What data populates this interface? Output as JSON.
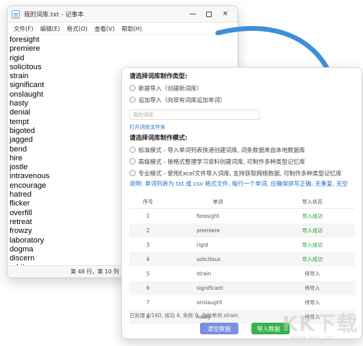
{
  "notepad": {
    "title": "我的词库.txt - 记事本",
    "menu": [
      "文件(F)",
      "编辑(E)",
      "格式(O)",
      "查看(V)",
      "帮助(H)"
    ],
    "lines": [
      "foresight",
      "premiere",
      "rigid",
      "solicitous",
      "strain",
      "significant",
      "onslaught",
      "hasty",
      "denial",
      "tempt",
      "bigoted",
      "jagged",
      "bend",
      "hire",
      "jostle",
      "intravenous",
      "encourage",
      "hatred",
      "flicker",
      "overfill",
      "retreat",
      "frowzy",
      "laboratory",
      "dogma",
      "discern",
      "arbitrary"
    ],
    "status": "第 48 行，第 10 列"
  },
  "tool": {
    "type_heading": "请选择词库制作类型:",
    "type_new": "新建导入（创建新词库）",
    "type_append": "追加导入（向现有词库追加单词）",
    "name_placeholder": "我的词库",
    "open_folder_link": "打开词库文件夹",
    "mode_heading": "请选择词库制作模式:",
    "mode_standard": "标准模式 - 导入单词列表快速创建词库, 词条数据来自本地数据库",
    "mode_advanced": "高级模式 - 按格式整理学习资料创建词库, 可制作多种类型记忆库",
    "mode_pro": "专业模式 - 使用Excel文件导入词库, 支持获取网络数据, 可制作多种类型记忆库",
    "note": "说明: 单词列表为 txt 或 csv 格式文件, 每行一个单词, 应确保拼写正确, 无重复, 无空",
    "table": {
      "headers": [
        "序号",
        "单词",
        "导入状态"
      ],
      "rows": [
        {
          "index": "1",
          "word": "foresight",
          "status": "导入成功"
        },
        {
          "index": "2",
          "word": "premiere",
          "status": "导入成功"
        },
        {
          "index": "3",
          "word": "rigid",
          "status": "导入成功"
        },
        {
          "index": "4",
          "word": "solicitous",
          "status": "导入成功"
        },
        {
          "index": "5",
          "word": "strain",
          "status": "待导入"
        },
        {
          "index": "6",
          "word": "significant",
          "status": "待导入"
        },
        {
          "index": "7",
          "word": "onslaught",
          "status": "待导入"
        },
        {
          "index": "8",
          "word": "hasty",
          "status": "待导入"
        }
      ]
    },
    "progress_text": "已处理 4/160, 成功 4, 失败 0, 当前单词 strain",
    "clear_button": "清空数据",
    "import_button": "导入数据"
  },
  "watermark": {
    "brand": "KK下载",
    "url": "www.kkx.net"
  },
  "colors": {
    "arrow": "#3d8fd8",
    "success": "#1e9e3a",
    "link": "#1a73c7",
    "clear_button": "#7a8fe0",
    "import_button": "#37b24d"
  }
}
